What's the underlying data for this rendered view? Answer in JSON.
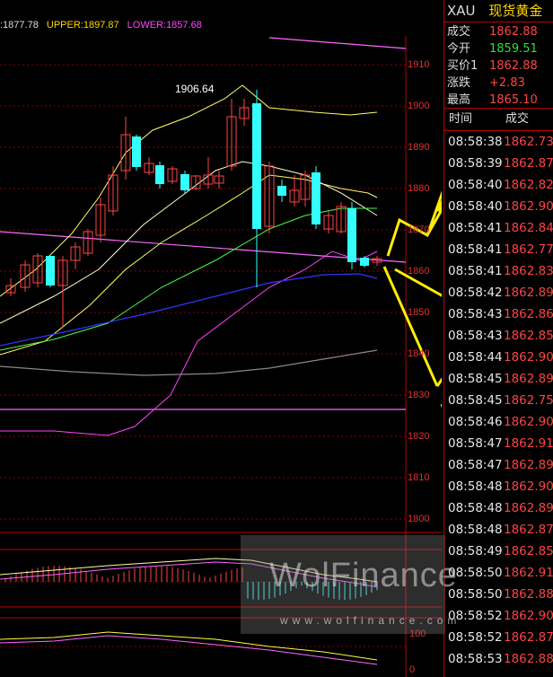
{
  "indicator_bar": {
    "mid": ":1877.78",
    "upper": "UPPER:1897.87",
    "lower": "LOWER:1857.68"
  },
  "annotation_high": "1906.64",
  "price_axis": [
    "1910",
    "1900",
    "1890",
    "1880",
    "1870",
    "1860",
    "1850",
    "1840",
    "1830",
    "1820",
    "1810",
    "1800"
  ],
  "lower_panel_axis": [
    "100",
    "0"
  ],
  "side": {
    "symbol": "XAU",
    "name": "现货黄金",
    "quotes": [
      {
        "label": "成交",
        "value": "1862.88",
        "color": "#ff4444"
      },
      {
        "label": "今开",
        "value": "1859.51",
        "color": "#33dd33"
      },
      {
        "label": "买价1",
        "value": "1862.88",
        "color": "#ff4444"
      },
      {
        "label": "涨跌",
        "value": "+2.83",
        "color": "#ff4444"
      },
      {
        "label": "最高",
        "value": "1865.10",
        "color": "#ff4444"
      }
    ],
    "tape_headers": {
      "time": "时间",
      "price": "成交"
    },
    "ticks": [
      {
        "time": "08:58:38",
        "price": "1862.73"
      },
      {
        "time": "08:58:39",
        "price": "1862.87"
      },
      {
        "time": "08:58:40",
        "price": "1862.82"
      },
      {
        "time": "08:58:40",
        "price": "1862.90"
      },
      {
        "time": "08:58:41",
        "price": "1862.84"
      },
      {
        "time": "08:58:41",
        "price": "1862.77"
      },
      {
        "time": "08:58:41",
        "price": "1862.83"
      },
      {
        "time": "08:58:42",
        "price": "1862.89"
      },
      {
        "time": "08:58:43",
        "price": "1862.86"
      },
      {
        "time": "08:58:43",
        "price": "1862.85"
      },
      {
        "time": "08:58:44",
        "price": "1862.90"
      },
      {
        "time": "08:58:45",
        "price": "1862.89"
      },
      {
        "time": "08:58:45",
        "price": "1862.75"
      },
      {
        "time": "08:58:46",
        "price": "1862.90"
      },
      {
        "time": "08:58:47",
        "price": "1862.91"
      },
      {
        "time": "08:58:47",
        "price": "1862.89"
      },
      {
        "time": "08:58:48",
        "price": "1862.90"
      },
      {
        "time": "08:58:48",
        "price": "1862.89"
      },
      {
        "time": "08:58:48",
        "price": "1862.87"
      },
      {
        "time": "08:58:49",
        "price": "1862.85"
      },
      {
        "time": "08:58:50",
        "price": "1862.91"
      },
      {
        "time": "08:58:50",
        "price": "1862.88"
      },
      {
        "time": "08:58:52",
        "price": "1862.90"
      },
      {
        "time": "08:58:52",
        "price": "1862.87"
      },
      {
        "time": "08:58:53",
        "price": "1862.88"
      }
    ]
  },
  "watermark": {
    "brand": "WolFinance",
    "url": "www.wolfinance.com"
  },
  "colors": {
    "up": "#ff4444",
    "down": "#33ffff",
    "grid": "#c00000",
    "arrow": "#ffee00"
  }
}
